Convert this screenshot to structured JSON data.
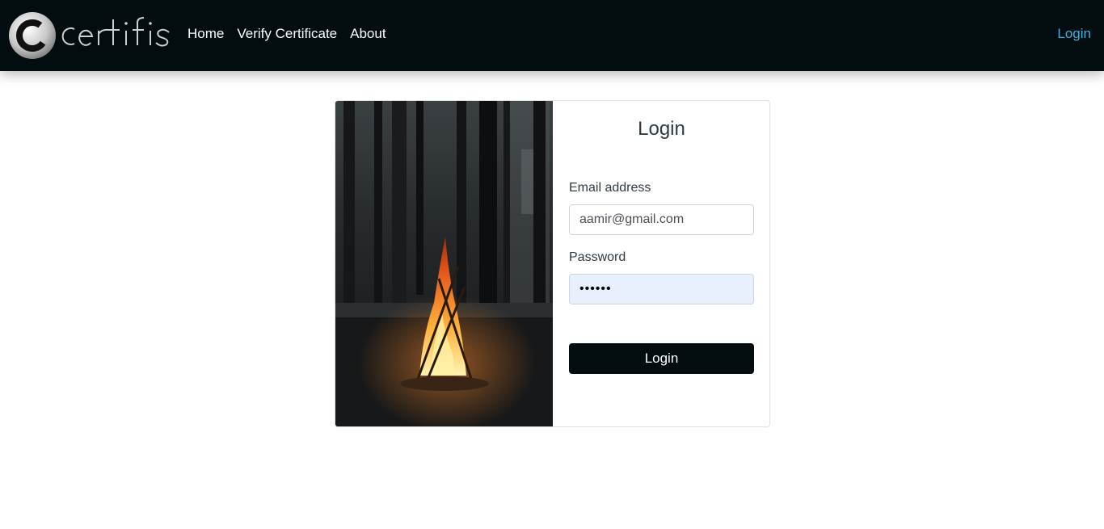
{
  "brand": {
    "logo_text": "certifis"
  },
  "nav": {
    "items": [
      {
        "label": "Home"
      },
      {
        "label": "Verify Certificate"
      },
      {
        "label": "About"
      }
    ],
    "login_label": "Login"
  },
  "login_form": {
    "title": "Login",
    "email_label": "Email address",
    "email_value": "aamir@gmail.com",
    "password_label": "Password",
    "password_value": "••••••",
    "submit_label": "Login"
  },
  "colors": {
    "navbar": "#030c0e",
    "accent_link": "#33b5e5",
    "autofill": "#e8f0fe"
  }
}
